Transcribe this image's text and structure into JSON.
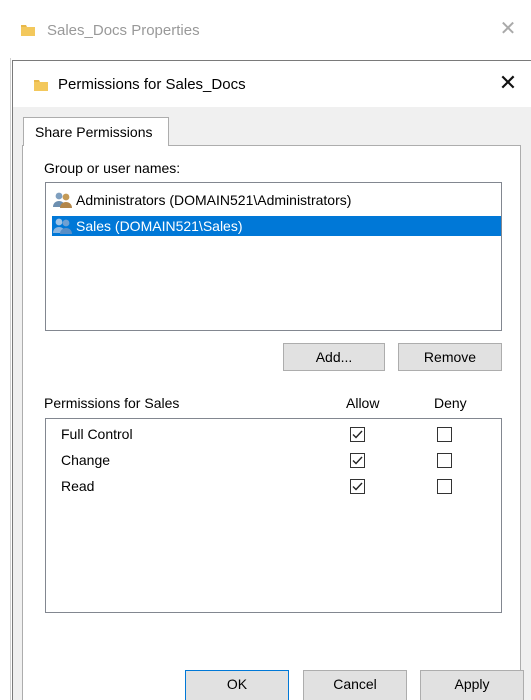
{
  "outer_window": {
    "title": "Sales_Docs Properties"
  },
  "dialog": {
    "title": "Permissions for Sales_Docs"
  },
  "tabs": [
    {
      "label": "Share Permissions"
    }
  ],
  "group_label": "Group or user names:",
  "users": [
    {
      "name": "Administrators (DOMAIN521\\Administrators)",
      "selected": false
    },
    {
      "name": "Sales (DOMAIN521\\Sales)",
      "selected": true
    }
  ],
  "buttons": {
    "add": "Add...",
    "remove": "Remove",
    "ok": "OK",
    "cancel": "Cancel",
    "apply": "Apply"
  },
  "permissions": {
    "header_label": "Permissions for Sales",
    "allow_label": "Allow",
    "deny_label": "Deny",
    "rows": [
      {
        "name": "Full Control",
        "allow": true,
        "deny": false
      },
      {
        "name": "Change",
        "allow": true,
        "deny": false
      },
      {
        "name": "Read",
        "allow": true,
        "deny": false
      }
    ]
  },
  "colors": {
    "selection": "#0078d7",
    "folder": "#e8b84a"
  },
  "icons": {
    "folder": "folder-icon",
    "user_group": "user-group-icon",
    "close": "close-icon"
  }
}
